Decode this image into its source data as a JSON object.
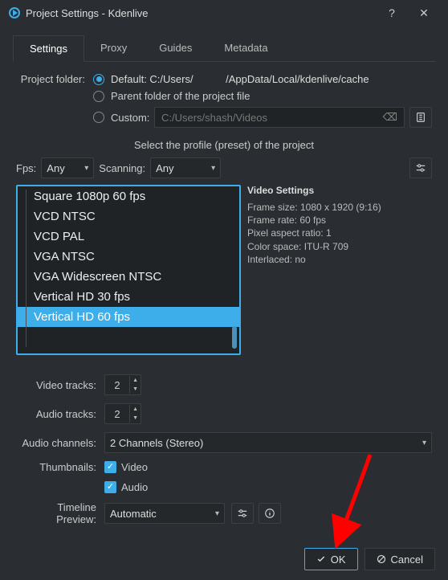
{
  "window": {
    "title": "Project Settings - Kdenlive",
    "help": "?",
    "close": "✕"
  },
  "tabs": [
    "Settings",
    "Proxy",
    "Guides",
    "Metadata"
  ],
  "folder": {
    "label": "Project folder:",
    "opt_default_pre": "Default: C:/Users/",
    "opt_default_post": "/AppData/Local/kdenlive/cache",
    "opt_parent": "Parent folder of the project file",
    "opt_custom": "Custom:",
    "custom_placeholder": "C:/Users/shash/Videos"
  },
  "profiles": {
    "section_title": "Select the profile (preset) of the project",
    "fps_label": "Fps:",
    "fps_value": "Any",
    "scanning_label": "Scanning:",
    "scanning_value": "Any",
    "items": [
      "Square 1080p 60 fps",
      "VCD NTSC",
      "VCD PAL",
      "VGA NTSC",
      "VGA Widescreen NTSC",
      "Vertical HD 30 fps",
      "Vertical HD 60 fps"
    ]
  },
  "vs": {
    "title": "Video Settings",
    "frame_size": "Frame size: 1080 x 1920 (9:16)",
    "frame_rate": "Frame rate: 60 fps",
    "par": "Pixel aspect ratio: 1",
    "colorspace": "Color space: ITU-R 709",
    "interlaced": "Interlaced: no"
  },
  "form": {
    "video_tracks_label": "Video tracks:",
    "video_tracks": "2",
    "audio_tracks_label": "Audio tracks:",
    "audio_tracks": "2",
    "audio_channels_label": "Audio channels:",
    "audio_channels": "2 Channels (Stereo)",
    "thumbnails_label": "Thumbnails:",
    "thumb_video": "Video",
    "thumb_audio": "Audio",
    "preview_label": "Timeline Preview:",
    "preview_value": "Automatic"
  },
  "buttons": {
    "ok": "OK",
    "cancel": "Cancel"
  }
}
